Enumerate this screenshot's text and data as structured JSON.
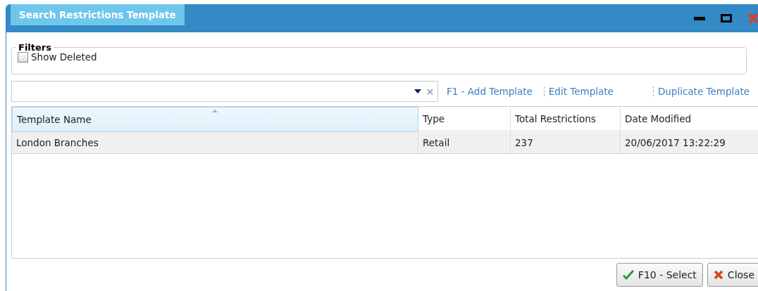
{
  "window": {
    "title": "Search Restrictions Template"
  },
  "filters": {
    "title": "Filters",
    "show_deleted": {
      "label": "Show Deleted",
      "checked": false
    }
  },
  "actions": [
    "F1 - Add Template",
    "Edit Template",
    "Duplicate Template"
  ],
  "table": {
    "columns": [
      {
        "label": "Template Name",
        "sorted": true
      },
      {
        "label": "Type",
        "sorted": false
      },
      {
        "label": "Total Restrictions",
        "sorted": false
      },
      {
        "label": "Date Modified",
        "sorted": false
      }
    ],
    "rows": [
      {
        "cells": [
          "London Branches",
          "Retail",
          "237",
          "20/06/2017 13:22:29"
        ],
        "selected": true
      }
    ]
  },
  "buttons": [
    {
      "kind": "ok",
      "label": "F10 - Select"
    },
    {
      "kind": "cancel",
      "label": "Close"
    }
  ]
}
